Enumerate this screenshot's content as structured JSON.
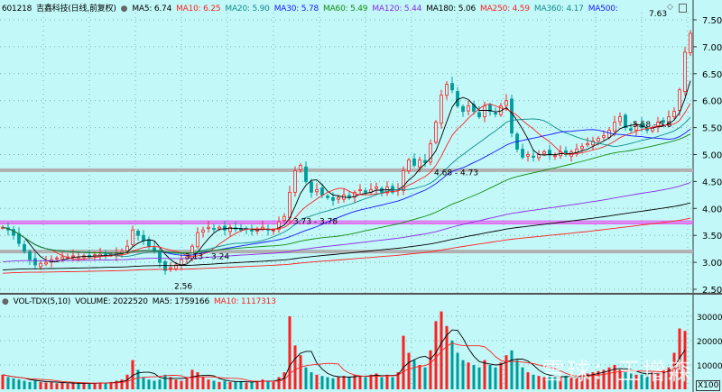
{
  "header": {
    "symbol": "601218",
    "name": "吉鑫科技(日线,前复权)",
    "ma_items": [
      {
        "label": "MA5: 6.74",
        "color": "#000000"
      },
      {
        "label": "MA10: 6.25",
        "color": "#ff2020"
      },
      {
        "label": "MA20: 5.90",
        "color": "#108c8c"
      },
      {
        "label": "MA30: 5.78",
        "color": "#1818ff"
      },
      {
        "label": "MA60: 5.49",
        "color": "#108c10"
      },
      {
        "label": "MA120: 5.44",
        "color": "#8a2be2"
      },
      {
        "label": "MA180: 5.06",
        "color": "#000000"
      },
      {
        "label": "MA250: 4.59",
        "color": "#ff2020"
      },
      {
        "label": "MA360: 4.17",
        "color": "#108c8c"
      },
      {
        "label": "MA500:",
        "color": "#1818ff"
      }
    ]
  },
  "volume_header": {
    "title": "VOL-TDX(5,10)",
    "volume": "VOLUME: 2022520",
    "ma5": "MA5: 1759166",
    "ma10": "MA10: 1117313"
  },
  "watermark": "雪球：王增森",
  "unit_label": "X100",
  "chart_data": [
    {
      "type": "candlestick",
      "title": "601218 吉鑫科技(日线,前复权)",
      "ylim": [
        2.35,
        7.75
      ],
      "y_ticks": [
        7.5,
        7.0,
        6.5,
        6.0,
        5.5,
        5.0,
        4.5,
        4.0,
        3.5,
        3.0,
        2.5
      ],
      "y_tick_labels": [
        "7.50",
        "7.00",
        "6.50",
        "6.00",
        "5.50",
        "5.00",
        "4.50",
        "4.00",
        "3.50",
        "3.00",
        "2.50"
      ],
      "closes": [
        3.65,
        3.6,
        3.5,
        3.35,
        3.2,
        3.05,
        2.95,
        2.98,
        3.0,
        3.05,
        3.08,
        3.1,
        3.1,
        3.12,
        3.1,
        3.12,
        3.1,
        3.14,
        3.15,
        3.12,
        3.15,
        3.18,
        3.2,
        3.3,
        3.6,
        3.5,
        3.4,
        3.3,
        3.2,
        3.0,
        2.85,
        2.9,
        2.95,
        3.05,
        3.1,
        3.3,
        3.55,
        3.6,
        3.65,
        3.62,
        3.65,
        3.6,
        3.65,
        3.62,
        3.6,
        3.62,
        3.58,
        3.6,
        3.65,
        3.6,
        3.6,
        3.75,
        3.85,
        4.3,
        4.7,
        4.8,
        4.5,
        4.3,
        4.35,
        4.25,
        4.2,
        4.15,
        4.2,
        4.25,
        4.2,
        4.3,
        4.35,
        4.3,
        4.35,
        4.4,
        4.3,
        4.4,
        4.3,
        4.35,
        4.7,
        4.9,
        4.8,
        4.9,
        4.85,
        5.2,
        5.6,
        6.1,
        6.3,
        6.2,
        5.9,
        5.8,
        5.9,
        5.8,
        5.7,
        5.9,
        5.8,
        5.75,
        5.9,
        6.0,
        5.4,
        5.1,
        4.95,
        5.0,
        4.95,
        5.0,
        5.05,
        5.0,
        4.98,
        5.05,
        5.0,
        5.05,
        5.1,
        5.15,
        5.2,
        5.25,
        5.3,
        5.35,
        5.45,
        5.6,
        5.7,
        5.5,
        5.45,
        5.55,
        5.5,
        5.45,
        5.5,
        5.6,
        5.6,
        5.7,
        5.8,
        6.2,
        6.9,
        7.25
      ],
      "levels": [
        {
          "price": 3.76,
          "color": "#e070f0"
        },
        {
          "price": 3.72,
          "color": "#e070f0"
        },
        {
          "price": 4.71,
          "color": "#b0b0b0"
        },
        {
          "price": 3.2,
          "color": "#b0b0b0"
        }
      ],
      "annotations": [
        {
          "text": "7.63",
          "price": 7.63,
          "index": 124
        },
        {
          "text": "2.56",
          "price": 2.56,
          "index": 31
        },
        {
          "text": "3.13 - 3.24",
          "price": 3.13,
          "index": 33
        },
        {
          "text": "3.73 - 3.78",
          "price": 3.78,
          "index": 53
        },
        {
          "text": "4.68 - 4.73",
          "price": 4.68,
          "index": 79
        },
        {
          "text": "5.58 - 5.6",
          "price": 5.58,
          "index": 121
        }
      ],
      "ma_periods": [
        5,
        10,
        20,
        30,
        60,
        120,
        180,
        250
      ]
    },
    {
      "type": "bar",
      "title": "VOL-TDX(5,10)",
      "ylim": [
        0,
        35000
      ],
      "y_ticks": [
        30000,
        20000,
        10000
      ],
      "y_tick_labels": [
        "30000",
        "20000",
        "10000"
      ],
      "volumes": [
        6000,
        5000,
        4500,
        4000,
        3500,
        3000,
        3500,
        3000,
        2800,
        3000,
        2500,
        2600,
        2400,
        2500,
        2300,
        2500,
        2400,
        2600,
        2800,
        2500,
        3000,
        3500,
        4000,
        6000,
        12000,
        8000,
        5000,
        4000,
        3500,
        4000,
        6000,
        5000,
        4000,
        3500,
        5000,
        8000,
        7000,
        5000,
        4000,
        3500,
        3000,
        3500,
        3000,
        3200,
        3000,
        2800,
        3000,
        3500,
        4000,
        3500,
        3000,
        5000,
        7000,
        30000,
        18000,
        14000,
        9000,
        7000,
        6000,
        5500,
        5000,
        4500,
        5000,
        5500,
        5000,
        6000,
        5500,
        5000,
        6000,
        6500,
        5000,
        6000,
        5000,
        7000,
        22000,
        15000,
        12000,
        10000,
        9000,
        16000,
        28000,
        32000,
        26000,
        20000,
        15000,
        12000,
        11000,
        10000,
        9000,
        12000,
        10000,
        9000,
        11000,
        14000,
        16000,
        12000,
        9000,
        7000,
        6000,
        5500,
        5000,
        5500,
        5000,
        5000,
        5500,
        5000,
        5500,
        6000,
        6500,
        7000,
        7500,
        8000,
        9000,
        10000,
        8000,
        7000,
        6500,
        6000,
        6000,
        6500,
        7000,
        7000,
        8000,
        9000,
        15000,
        25000,
        24000
      ]
    }
  ]
}
